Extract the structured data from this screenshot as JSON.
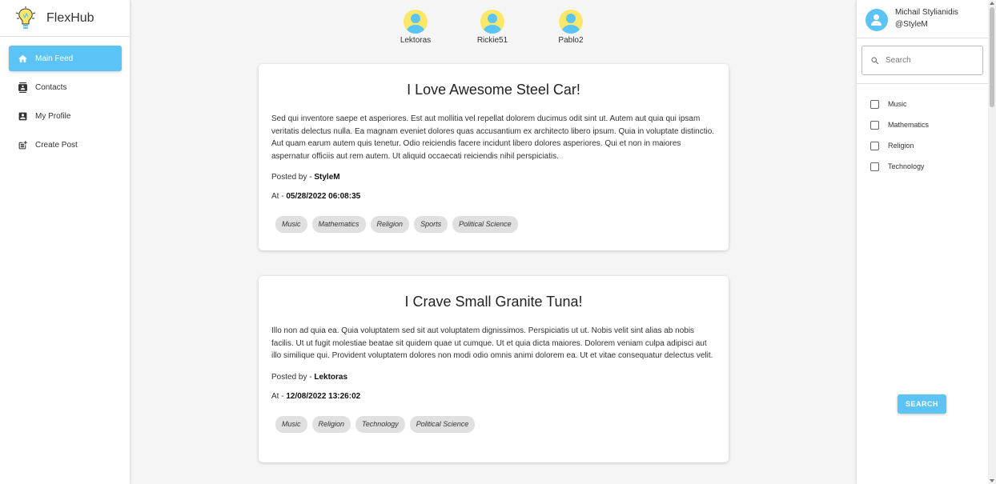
{
  "app": {
    "name": "FlexHub"
  },
  "nav": {
    "items": [
      {
        "label": "Main Feed",
        "icon": "home-icon",
        "active": true
      },
      {
        "label": "Contacts",
        "icon": "contacts-icon"
      },
      {
        "label": "My Profile",
        "icon": "profile-icon"
      },
      {
        "label": "Create Post",
        "icon": "post-add-icon"
      }
    ]
  },
  "stories": [
    {
      "label": "Lektoras"
    },
    {
      "label": "Rickie51"
    },
    {
      "label": "Pablo2"
    }
  ],
  "posts": [
    {
      "title": "I Love Awesome Steel Car!",
      "body": "Sed qui inventore saepe et asperiores. Est aut mollitia vel repellat dolorem ducimus odit sint ut. Autem aut quia qui ipsam veritatis delectus nulla. Ea magnam eveniet dolores quas accusantium ex architecto libero ipsum. Quia in voluptate distinctio. Aut quam earum autem quis tenetur. Odio reiciendis facere incidunt libero dolores asperiores. Qui et non in maiores aspernatur officiis aut rem autem. Ut aliquid occaecati reiciendis nihil perspiciatis.",
      "posted_by_label": "Posted by - ",
      "author": "StyleM",
      "at_label": "At - ",
      "timestamp": "05/28/2022 06:08:35",
      "tags": [
        "Music",
        "Mathematics",
        "Religion",
        "Sports",
        "Political Science"
      ]
    },
    {
      "title": "I Crave Small Granite Tuna!",
      "body": "Illo non ad quia ea. Quia voluptatem sed sit aut voluptatem dignissimos. Perspiciatis ut ut. Nobis velit sint alias ab nobis facilis. Ut ut fugit molestiae beatae sit quidem quae ut cumque. Ut et quia dicta maiores. Dolorem veniam culpa adipisci aut illo similique qui. Provident voluptatem dolores non modi odio omnis animi dolorem ea. Ut et vitae consequatur delectus velit.",
      "posted_by_label": "Posted by - ",
      "author": "Lektoras",
      "at_label": "At - ",
      "timestamp": "12/08/2022 13:26:02",
      "tags": [
        "Music",
        "Religion",
        "Technology",
        "Political Science"
      ]
    }
  ],
  "user": {
    "name": "Michail Stylianidis",
    "handle": "@StyleM"
  },
  "search": {
    "placeholder": "Search",
    "value": "",
    "button_label": "SEARCH"
  },
  "filters": [
    {
      "label": "Music",
      "checked": false
    },
    {
      "label": "Mathematics",
      "checked": false
    },
    {
      "label": "Religion",
      "checked": false
    },
    {
      "label": "Technology",
      "checked": false
    }
  ],
  "colors": {
    "accent": "#5bc4f5",
    "avatar_bg": "#fde768",
    "tag_bg": "#e0e0e0"
  }
}
